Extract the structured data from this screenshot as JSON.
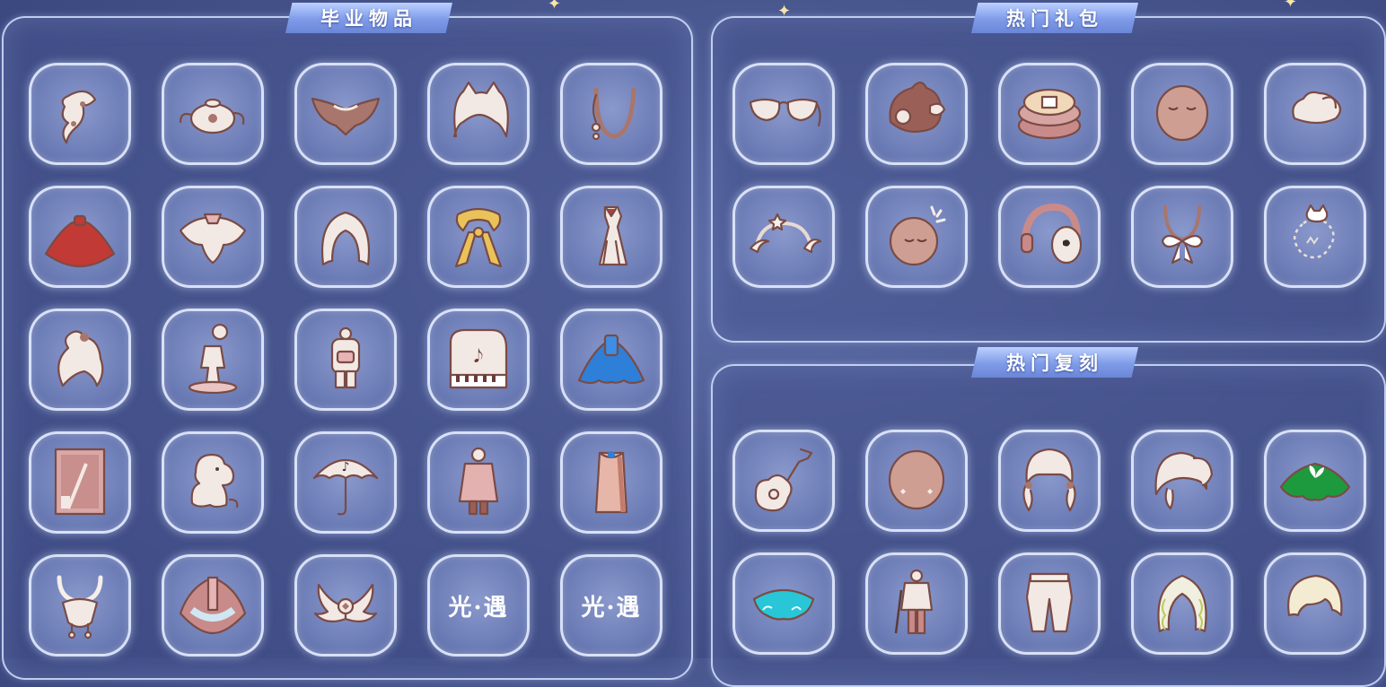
{
  "sections": {
    "graduation": {
      "title": "毕业物品"
    },
    "hot_gifts": {
      "title": "热门礼包"
    },
    "hot_reruns": {
      "title": "热门复刻"
    }
  },
  "graduation_items": [
    {
      "icon": "braid-hair-icon"
    },
    {
      "icon": "teapot-icon"
    },
    {
      "icon": "moth-wing-mask-icon"
    },
    {
      "icon": "cat-ear-hair-icon"
    },
    {
      "icon": "pendant-necklace-icon"
    },
    {
      "icon": "red-cape-icon"
    },
    {
      "icon": "pink-wing-cape-icon"
    },
    {
      "icon": "long-hair-icon"
    },
    {
      "icon": "golden-scarf-icon"
    },
    {
      "icon": "dress-outfit-icon"
    },
    {
      "icon": "bun-hair-icon"
    },
    {
      "icon": "statue-prop-icon"
    },
    {
      "icon": "backpack-outfit-icon"
    },
    {
      "icon": "piano-icon"
    },
    {
      "icon": "blue-cape-icon"
    },
    {
      "icon": "painting-card-icon"
    },
    {
      "icon": "moomin-doll-icon"
    },
    {
      "icon": "umbrella-icon"
    },
    {
      "icon": "coat-outfit-icon"
    },
    {
      "icon": "robe-outfit-icon"
    },
    {
      "icon": "antler-mask-icon"
    },
    {
      "icon": "ornate-cape-icon"
    },
    {
      "icon": "wing-mask-icon"
    },
    {
      "icon": "sky-logo-icon",
      "text": "光·遇"
    },
    {
      "icon": "sky-logo-icon",
      "text": "光·遇"
    }
  ],
  "gift_items": [
    {
      "icon": "sunglasses-icon"
    },
    {
      "icon": "bear-hat-icon"
    },
    {
      "icon": "cake-prop-icon"
    },
    {
      "icon": "sleepy-mask-icon"
    },
    {
      "icon": "hair-clip-icon"
    },
    {
      "icon": "moon-headband-icon"
    },
    {
      "icon": "sparkle-mask-icon"
    },
    {
      "icon": "headphones-icon"
    },
    {
      "icon": "bow-necklace-icon"
    },
    {
      "icon": "cat-spirit-icon"
    }
  ],
  "rerun_items": [
    {
      "icon": "guitar-icon"
    },
    {
      "icon": "blush-mask-icon"
    },
    {
      "icon": "twin-tail-hair-icon"
    },
    {
      "icon": "ponytail-hair-icon"
    },
    {
      "icon": "green-cape-icon"
    },
    {
      "icon": "cyan-cape-icon"
    },
    {
      "icon": "swordsman-outfit-icon"
    },
    {
      "icon": "pants-icon"
    },
    {
      "icon": "curly-hair-icon"
    },
    {
      "icon": "short-hair-icon"
    }
  ],
  "colors": {
    "background": "#4a5890",
    "slot_fill": "#7484be",
    "slot_border": "#e4ecff",
    "item_cream": "#f3e9e4",
    "item_brown": "#a8766c",
    "item_red": "#c13a35",
    "item_gold": "#e9c35a",
    "item_blue": "#2e7fd8",
    "item_green": "#1e9a3e",
    "item_cyan": "#28c6d6"
  }
}
